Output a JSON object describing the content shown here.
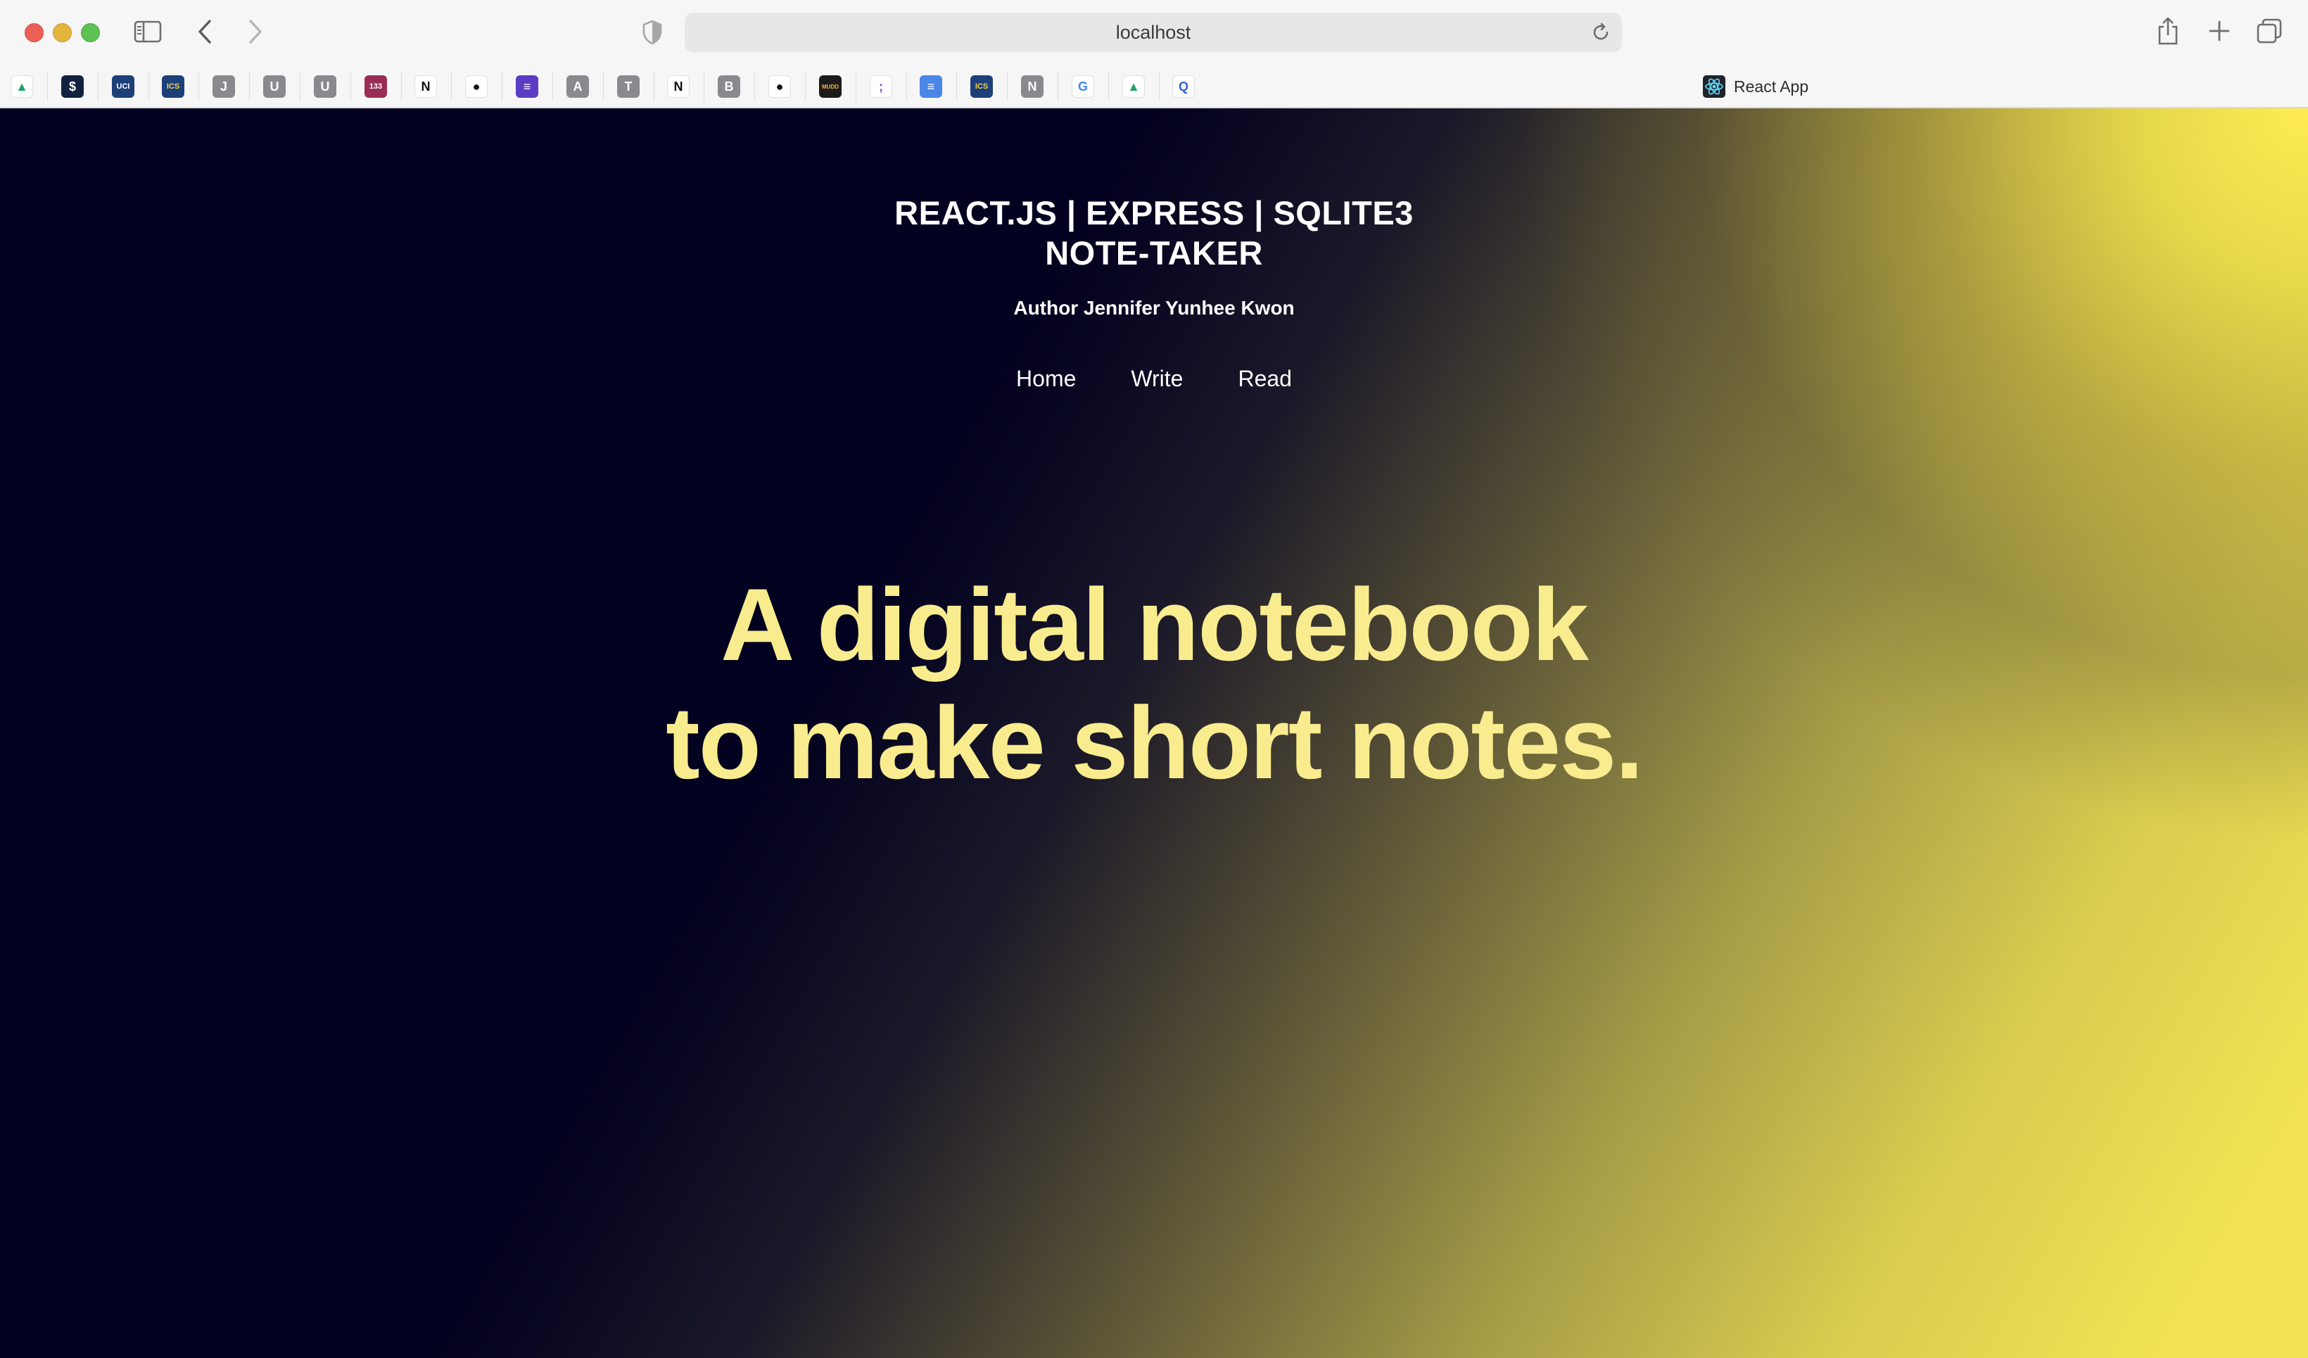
{
  "browser": {
    "address": "localhost",
    "active_tab_title": "React App",
    "favorites": [
      {
        "icon": "google-drive-icon",
        "glyph": "▲",
        "bg": "#ffffff",
        "fg": "#1fa463"
      },
      {
        "icon": "dollar-icon",
        "glyph": "$",
        "bg": "#10223f",
        "fg": "#ffffff"
      },
      {
        "icon": "uci-icon",
        "glyph": "UCI",
        "bg": "#1d3f7a",
        "fg": "#ffffff"
      },
      {
        "icon": "uci-ics-icon",
        "glyph": "ICS",
        "bg": "#1d3f7a",
        "fg": "#f6d34a"
      },
      {
        "icon": "letter-j-icon",
        "glyph": "J",
        "bg": "#8a8a8e",
        "fg": "#ffffff"
      },
      {
        "icon": "letter-u-icon",
        "glyph": "U",
        "bg": "#8a8a8e",
        "fg": "#ffffff"
      },
      {
        "icon": "letter-u-icon-2",
        "glyph": "U",
        "bg": "#8a8a8e",
        "fg": "#ffffff"
      },
      {
        "icon": "badge-133-icon",
        "glyph": "133",
        "bg": "#9a2d55",
        "fg": "#ffffff"
      },
      {
        "icon": "notion-icon",
        "glyph": "N",
        "bg": "#ffffff",
        "fg": "#111111"
      },
      {
        "icon": "github-icon",
        "glyph": "●",
        "bg": "#ffffff",
        "fg": "#111111"
      },
      {
        "icon": "list-icon",
        "glyph": "≡",
        "bg": "#5b3cc4",
        "fg": "#ffffff"
      },
      {
        "icon": "letter-a-icon",
        "glyph": "A",
        "bg": "#8a8a8e",
        "fg": "#ffffff"
      },
      {
        "icon": "letter-t-icon",
        "glyph": "T",
        "bg": "#8a8a8e",
        "fg": "#ffffff"
      },
      {
        "icon": "notion-icon-2",
        "glyph": "N",
        "bg": "#ffffff",
        "fg": "#111111"
      },
      {
        "icon": "letter-b-icon",
        "glyph": "B",
        "bg": "#8a8a8e",
        "fg": "#ffffff"
      },
      {
        "icon": "github-icon-2",
        "glyph": "●",
        "bg": "#ffffff",
        "fg": "#111111"
      },
      {
        "icon": "mudd-icon",
        "glyph": "MUDD",
        "bg": "#1b1b1b",
        "fg": "#f2b33d"
      },
      {
        "icon": "semicolon-icon",
        "glyph": ";",
        "bg": "#ffffff",
        "fg": "#7b3fc2"
      },
      {
        "icon": "google-docs-icon",
        "glyph": "≡",
        "bg": "#4a86e8",
        "fg": "#ffffff"
      },
      {
        "icon": "uci-ics-icon-2",
        "glyph": "ICS",
        "bg": "#1d3f7a",
        "fg": "#f6d34a"
      },
      {
        "icon": "letter-n-icon",
        "glyph": "N",
        "bg": "#8a8a8e",
        "fg": "#ffffff"
      },
      {
        "icon": "google-icon",
        "glyph": "G",
        "bg": "#ffffff",
        "fg": "#4285f4"
      },
      {
        "icon": "google-drive-icon-2",
        "glyph": "▲",
        "bg": "#ffffff",
        "fg": "#1fa463"
      },
      {
        "icon": "q-icon",
        "glyph": "Q",
        "bg": "#ffffff",
        "fg": "#2f5fd0"
      }
    ]
  },
  "page": {
    "title_line1": "REACT.JS | EXPRESS | SQLITE3",
    "title_line2": "NOTE-TAKER",
    "author": "Author Jennifer Yunhee Kwon",
    "nav": [
      "Home",
      "Write",
      "Read"
    ],
    "hero_line1": "A digital notebook",
    "hero_line2": "to make short notes."
  },
  "colors": {
    "background_dark": "#02011f",
    "background_light": "#f4e454",
    "hero_text": "#f8ec8f",
    "header_text": "#ffffff"
  }
}
